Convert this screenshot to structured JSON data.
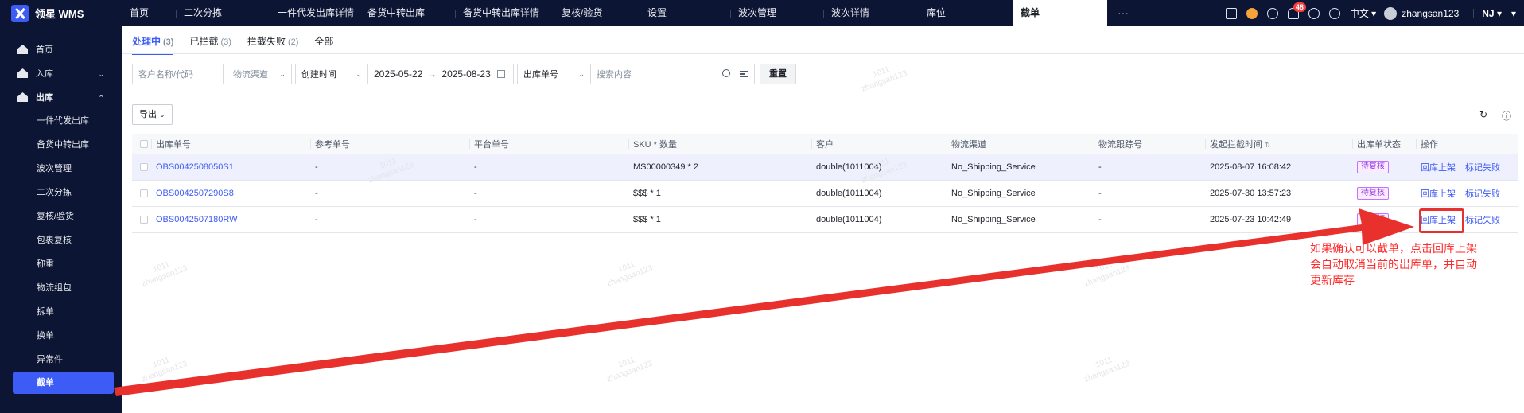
{
  "app": {
    "title": "领星 WMS"
  },
  "topbar": {
    "tabs": [
      "首页",
      "二次分拣",
      "一件代发出库详情",
      "备货中转出库",
      "备货中转出库详情",
      "复核/验货",
      "设置",
      "波次管理",
      "波次详情",
      "库位",
      "截单"
    ],
    "more_label": "···",
    "notification_count": "48",
    "language": "中文",
    "username": "zhangsan123",
    "warehouse": "NJ"
  },
  "sidebar": {
    "items": [
      {
        "label": "首页"
      },
      {
        "label": "入库"
      },
      {
        "label": "出库"
      }
    ],
    "sub_items": [
      "一件代发出库",
      "备货中转出库",
      "波次管理",
      "二次分拣",
      "复核/验货",
      "包裹复核",
      "称重",
      "物流组包",
      "拆单",
      "换单",
      "异常件",
      "截单"
    ]
  },
  "subtabs": [
    {
      "label": "处理中",
      "count": "(3)"
    },
    {
      "label": "已拦截",
      "count": "(3)"
    },
    {
      "label": "拦截失败",
      "count": "(2)"
    },
    {
      "label": "全部",
      "count": ""
    }
  ],
  "filters": {
    "customer_placeholder": "客户名称/代码",
    "channel_placeholder": "物流渠道",
    "time_type": "创建时间",
    "date_start": "2025-05-22",
    "date_arrow": "→",
    "date_end": "2025-08-23",
    "search_type": "出库单号",
    "search_placeholder": "搜索内容",
    "reset_label": "重置"
  },
  "toolbar": {
    "export_label": "导出",
    "refresh_icon": "refresh-icon",
    "help_icon": "help-icon"
  },
  "table": {
    "headers": [
      "出库单号",
      "参考单号",
      "平台单号",
      "SKU * 数量",
      "客户",
      "物流渠道",
      "物流跟踪号",
      "发起拦截时间",
      "出库单状态",
      "操作"
    ],
    "rows": [
      {
        "order": "OBS0042508050S1",
        "ref": "-",
        "platform": "-",
        "sku": "MS00000349 * 2",
        "customer": "double(1011004)",
        "channel": "No_Shipping_Service",
        "tracking": "-",
        "time": "2025-08-07 16:08:42",
        "status": "待复核",
        "act1": "回库上架",
        "act2": "标记失败"
      },
      {
        "order": "OBS0042507290S8",
        "ref": "-",
        "platform": "-",
        "sku": "$$$ * 1",
        "customer": "double(1011004)",
        "channel": "No_Shipping_Service",
        "tracking": "-",
        "time": "2025-07-30 13:57:23",
        "status": "待复核",
        "act1": "回库上架",
        "act2": "标记失败"
      },
      {
        "order": "OBS0042507180RW",
        "ref": "-",
        "platform": "-",
        "sku": "$$$ * 1",
        "customer": "double(1011004)",
        "channel": "No_Shipping_Service",
        "tracking": "-",
        "time": "2025-07-23 10:42:49",
        "status": "待复核",
        "act1": "回库上架",
        "act2": "标记失败"
      }
    ]
  },
  "watermark": {
    "line1": "1011",
    "line2": "zhangsan123"
  },
  "annotation": {
    "lines": [
      "如果确认可以截单，点击回库上架",
      "会自动取消当前的出库单，并自动",
      "更新库存"
    ],
    "color": "#ff2a2a"
  },
  "colors": {
    "accent": "#3d5bf5",
    "topbar": "#0c1533",
    "status": "#9b33e6"
  }
}
